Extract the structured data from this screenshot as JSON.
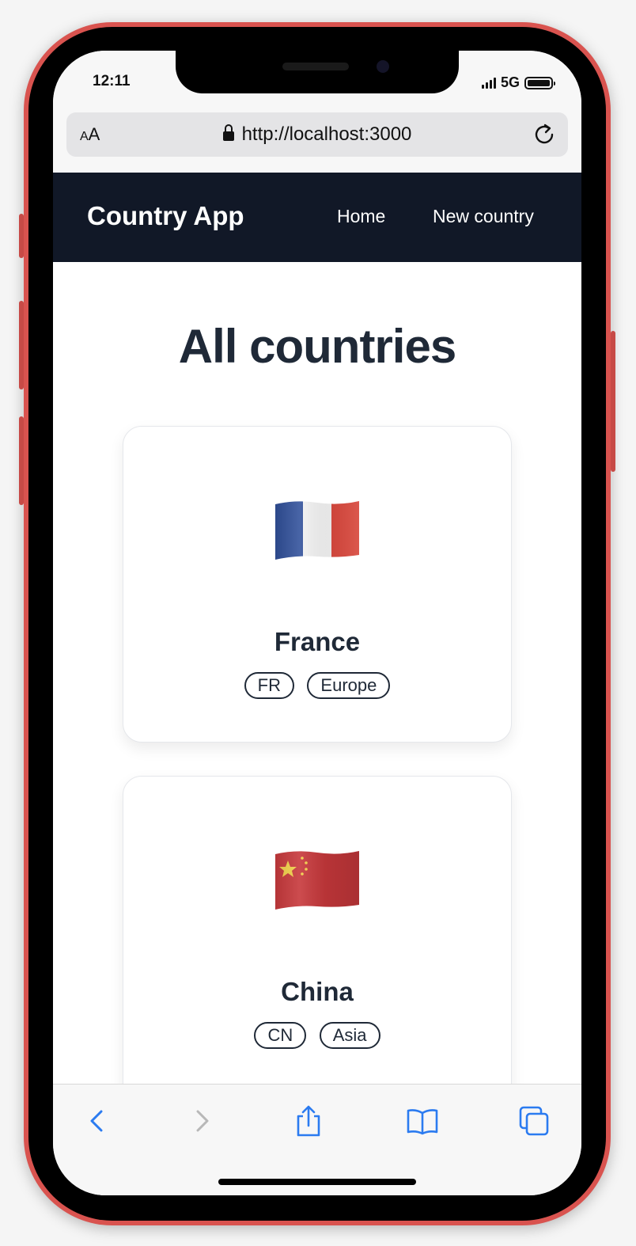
{
  "status_bar": {
    "time": "12:11",
    "network": "5G"
  },
  "browser": {
    "aa_small": "A",
    "aa_large": "A",
    "url": "http://localhost:3000"
  },
  "nav": {
    "brand": "Country App",
    "links": [
      {
        "label": "Home"
      },
      {
        "label": "New country"
      }
    ]
  },
  "page": {
    "title": "All countries",
    "countries": [
      {
        "name": "France",
        "code": "FR",
        "region": "Europe",
        "flag": "france-flag"
      },
      {
        "name": "China",
        "code": "CN",
        "region": "Asia",
        "flag": "china-flag"
      }
    ]
  },
  "toolbar": {
    "icons": [
      "back-icon",
      "forward-icon",
      "share-icon",
      "bookmarks-icon",
      "tabs-icon"
    ],
    "accent_color": "#2b7bf0",
    "disabled_color": "#b8b8b8"
  },
  "colors": {
    "nav_background": "#111827",
    "frame": "#d9534f",
    "text_dark": "#1f2937"
  }
}
